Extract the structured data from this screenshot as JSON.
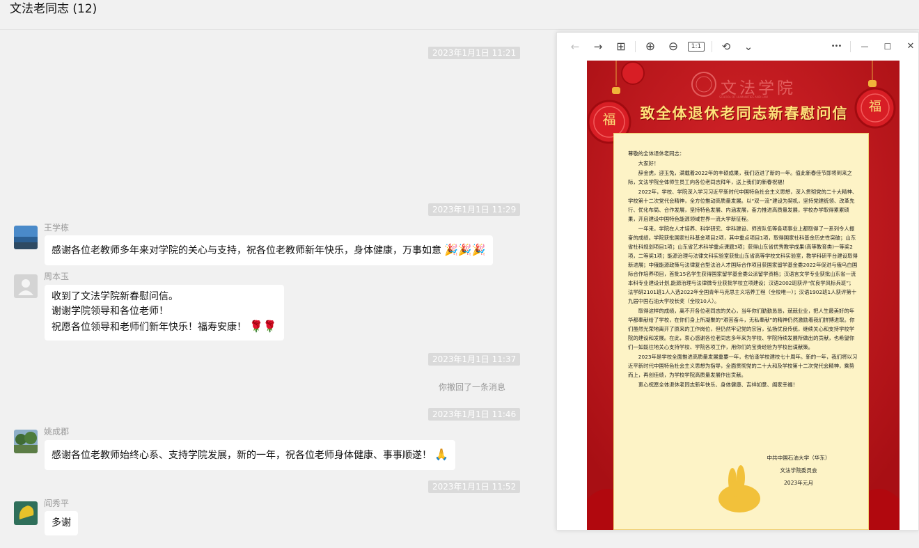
{
  "chat": {
    "title": "文法老同志 (12)",
    "timestamps": [
      "2023年1月1日 11:21",
      "2023年1月1日 11:29",
      "2023年1月1日 11:37",
      "2023年1月1日 11:46",
      "2023年1月1日 11:52"
    ],
    "system_note": "你撤回了一条消息",
    "messages": [
      {
        "sender": "王学栋",
        "lines": [
          "感谢各位老教师多年来对学院的关心与支持，祝各位老教师新年快乐，身体健康，万事如意"
        ],
        "emoji": "🎉🎉🎉"
      },
      {
        "sender": "周本玉",
        "lines": [
          "收到了文法学院新春慰问信。",
          "谢谢学院领导和各位老师！",
          "祝愿各位领导和老师们新年快乐！福寿安康！"
        ],
        "emoji": "🌹🌹"
      },
      {
        "sender": "姚成郡",
        "lines": [
          "感谢各位老教师始终心系、支持学院发展，新的一年，祝各位老师身体健康、事事顺遂！"
        ],
        "emoji": "🙏"
      },
      {
        "sender": "阎秀平",
        "lines": [
          "多谢"
        ],
        "emoji": ""
      }
    ]
  },
  "viewer": {
    "toolbar": {
      "back_icon": "←",
      "forward_icon": "→",
      "grid_icon": "⊞",
      "zoom_in_icon": "⊕",
      "zoom_out_icon": "⊖",
      "actual_size_icon": "1:1",
      "rotate_icon": "⟲",
      "dropdown_icon": "⌄",
      "more_icon": "•••",
      "minimize_icon": "—",
      "maximize_icon": "☐",
      "close_icon": "✕"
    },
    "poster": {
      "school_name": "文法学院",
      "school_sub": "SCHOOL OF HUMANITIES AND LAW",
      "headline": "致全体退休老同志新春慰问信",
      "fu_char": "福",
      "greeting": "尊敬的全体退休老同志：",
      "hello": "大家好！",
      "paragraphs": [
        "辞金虎，迎玉兔，满载着2022年的丰硕成果，我们迈进了新的一年。值此新春佳节即将到来之际，文法学院全体师生员工向各位老同志拜年，送上我们的新春祝福！",
        "2022年，学校、学院深入学习习近平新时代中国特色社会主义思想，深入贯彻党的二十大精神、学校第十二次党代会精神，全方位推动高质量发展。以“双一流”建设为契机，坚持党建统领、改革先行、优化布局、合作发展，坚持特色发展、内涵发展，奋力推进高质量发展，学校办学取得累累硕果，开启建设中国特色能源领域世界一流大学新征程。",
        "一年来，学院在人才培养、科学研究、学科建设、师资队伍等各项事业上都取得了一系列令人振奋的成绩。学院获批国家社科基金项目2项，其中重点项目1项，取得国家社科基金历史性突破；山东省社科规划项目1项；山东省艺术科学重点课题3项；获得山东省优秀教学成果(高等教育类)一等奖2项，二等奖1项；能源治理与法律文科实验室获批山东省高等学校文科实验室，教学科研平台建设取得新进展；中俄能源政策与法律复合型法治人才国际合作项目获国家留学基金委2022年促进与俄乌白国际合作培养项目，首批15名学生获得国家留学基金委公派留学资格；汉语言文学专业获批山东省一流本科专业建设计划,能源治理与法律微专业获批学校立项建设；汉语2002班获评“优良学风标兵班”；法学研2101班1人入选2022年全国青年马克思主义培养工程（全校唯一）；汉语1902班1人获评第十九届中国石油大学校长奖（全校10人）。",
        "取得这样的成绩，离不开各位老同志的关心，当年你们勤勤恳恳，兢兢业业，把人生最美好的年华都奉献给了学校，在你们身上所凝聚的“艰苦奋斗，无私奉献”的精神仍然激励着我们拼搏进取。你们虽然光荣地离开了原来的工作岗位，但仍然牢记党的宗旨，弘扬优良传统，继续关心和支持学校学院的建设和发展。在此，衷心感谢各位老同志多年来为学校、学院持续发展所做出的贡献，也希望你们一如既往地关心支持学校、学院各项工作，用你们的宝贵经验为学校出谋献策。",
        "2023年是学校全面推进高质量发展重要一年，也恰逢学校建校七十周年。新的一年，我们将以习近平新时代中国特色社会主义思想为指导，全面贯彻党的二十大和及学校第十二次党代会精神，乘势而上，再创佳绩，为学校学院高质量发展作出贡献。",
        "衷心祝愿全体退休老同志新年快乐、身体健康、吉祥如意、阖家幸福！"
      ],
      "signature": [
        "中共中国石油大学（华东）",
        "文法学院委员会",
        "2023年元月"
      ]
    }
  }
}
